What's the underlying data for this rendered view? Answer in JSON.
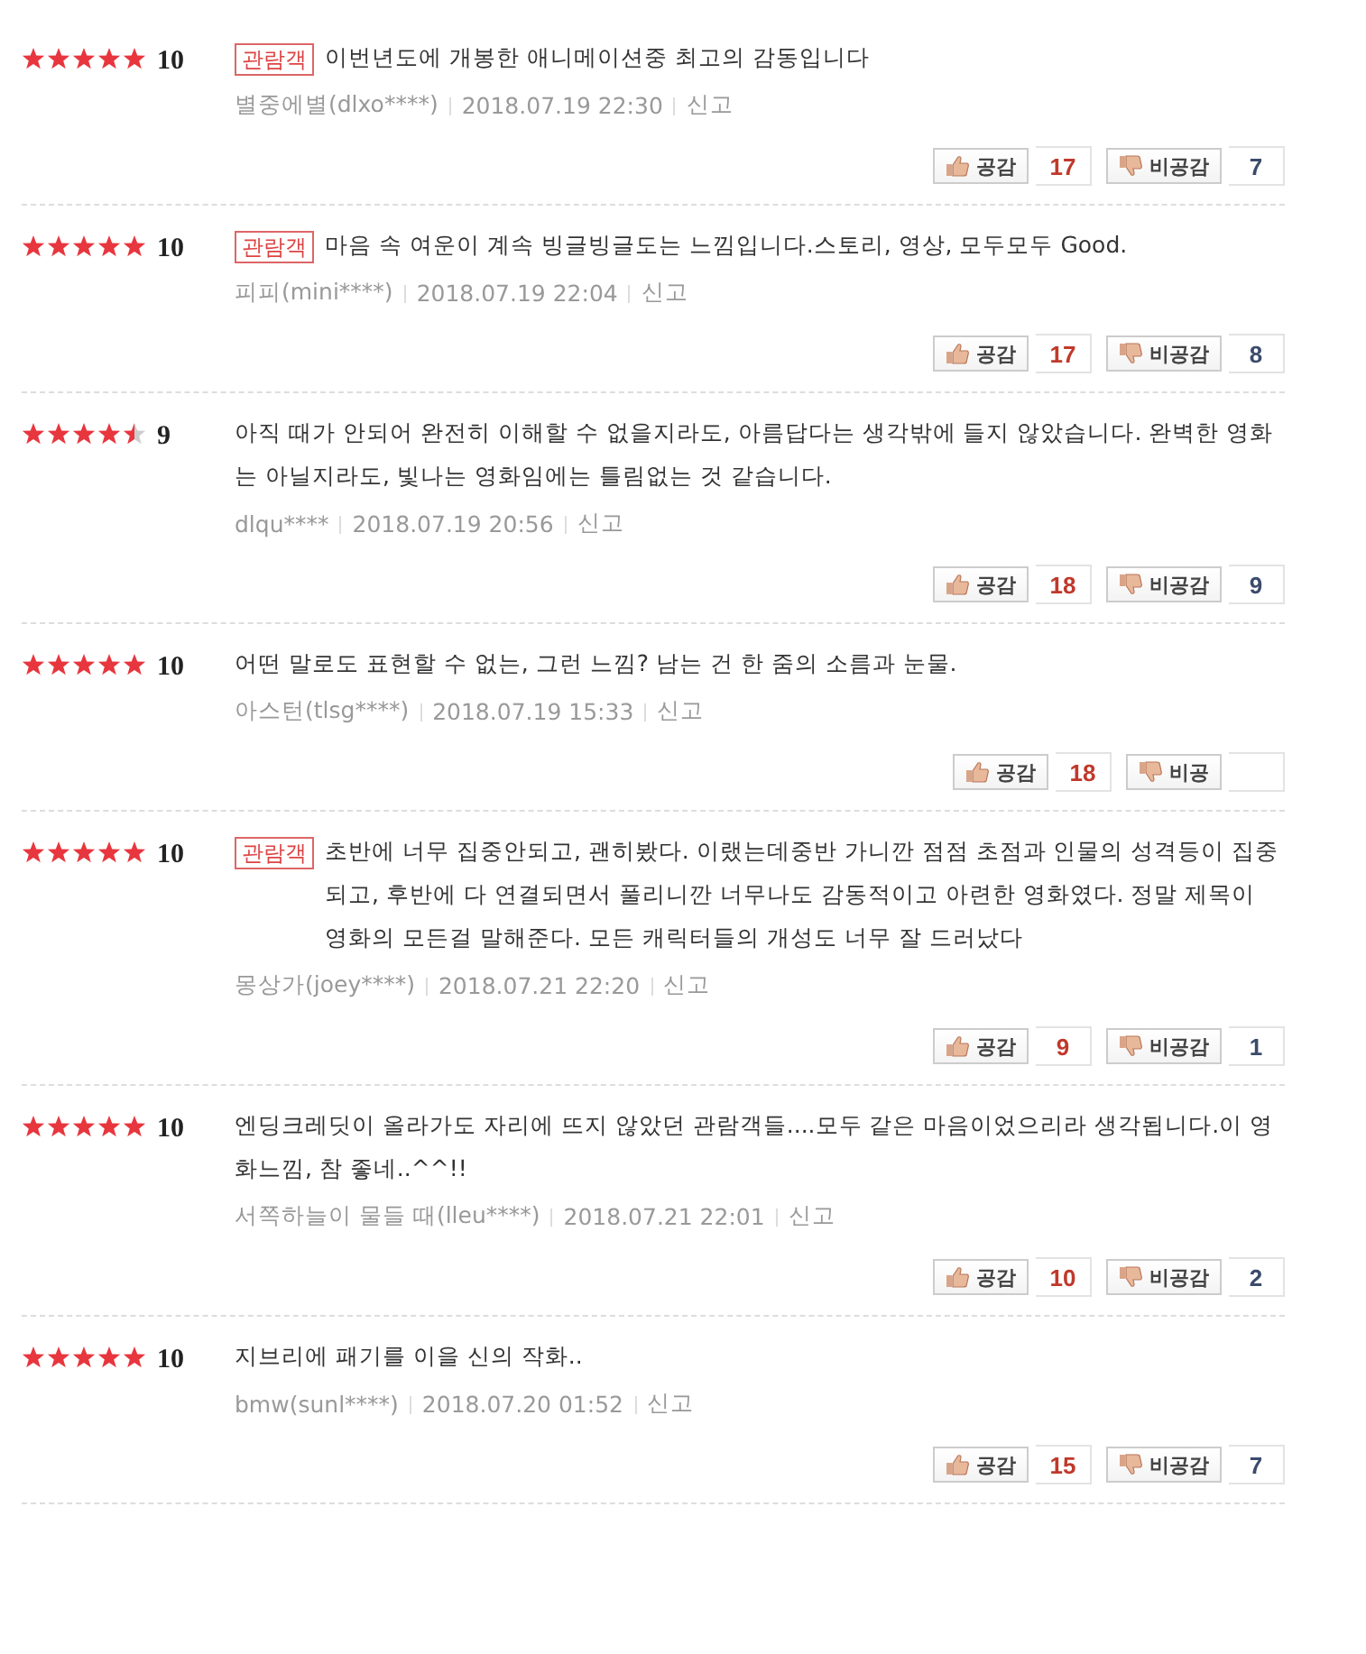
{
  "reviews": [
    {
      "stars": 5,
      "score": "10",
      "badge": "관람객",
      "text": "이번년도에 개봉한 애니메이션중 최고의 감동입니다",
      "author": "별중에별(dlxo****)",
      "date": "2018.07.19 22:30",
      "report": "신고",
      "like_label": "공감",
      "like_count": "17",
      "dislike_label": "비공감",
      "dislike_count": "7"
    },
    {
      "stars": 5,
      "score": "10",
      "badge": "관람객",
      "text": "마음 속 여운이 계속 빙글빙글도는 느낌입니다.스토리, 영상, 모두모두 Good.",
      "author": "피피(mini****)",
      "date": "2018.07.19 22:04",
      "report": "신고",
      "like_label": "공감",
      "like_count": "17",
      "dislike_label": "비공감",
      "dislike_count": "8"
    },
    {
      "stars": 4.5,
      "score": "9",
      "text": "아직 때가 안되어 완전히 이해할 수 없을지라도, 아름답다는 생각밖에 들지 않았습니다. 완벽한 영화는 아닐지라도, 빛나는 영화임에는 틀림없는 것 같습니다.",
      "author": "dlqu****",
      "date": "2018.07.19 20:56",
      "report": "신고",
      "like_label": "공감",
      "like_count": "18",
      "dislike_label": "비공감",
      "dislike_count": "9"
    },
    {
      "stars": 5,
      "score": "10",
      "text": "어떤 말로도 표현할 수 없는, 그런 느낌? 남는 건 한 줌의 소름과 눈물.",
      "author": "아스턴(tlsg****)",
      "date": "2018.07.19 15:33",
      "report": "신고",
      "like_label": "공감",
      "like_count": "18",
      "dislike_label": "비공"
    },
    {
      "stars": 5,
      "score": "10",
      "badge": "관람객",
      "text": "초반에 너무 집중안되고, 괜히봤다. 이랬는데중반 가니깐 점점 초점과 인물의 성격등이 집중되고, 후반에 다 연결되면서 풀리니깐 너무나도 감동적이고 아련한 영화였다. 정말 제목이 영화의 모든걸 말해준다. 모든 캐릭터들의 개성도 너무 잘 드러났다",
      "author": "몽상가(joey****)",
      "date": "2018.07.21 22:20",
      "report": "신고",
      "like_label": "공감",
      "like_count": "9",
      "dislike_label": "비공감",
      "dislike_count": "1"
    },
    {
      "stars": 5,
      "score": "10",
      "text": "엔딩크레딧이 올라가도 자리에 뜨지 않았던 관람객들....모두 같은 마음이었으리라 생각됩니다.이 영화느낌, 참 좋네..^^!!",
      "author": "서쪽하늘이 물들 때(lleu****)",
      "date": "2018.07.21 22:01",
      "report": "신고",
      "like_label": "공감",
      "like_count": "10",
      "dislike_label": "비공감",
      "dislike_count": "2"
    },
    {
      "stars": 5,
      "score": "10",
      "text": "지브리에 패기를 이을 신의 작화..",
      "author": "bmw(sunl****)",
      "date": "2018.07.20 01:52",
      "report": "신고",
      "like_label": "공감",
      "like_count": "15",
      "dislike_label": "비공감",
      "dislike_count": "7"
    }
  ]
}
